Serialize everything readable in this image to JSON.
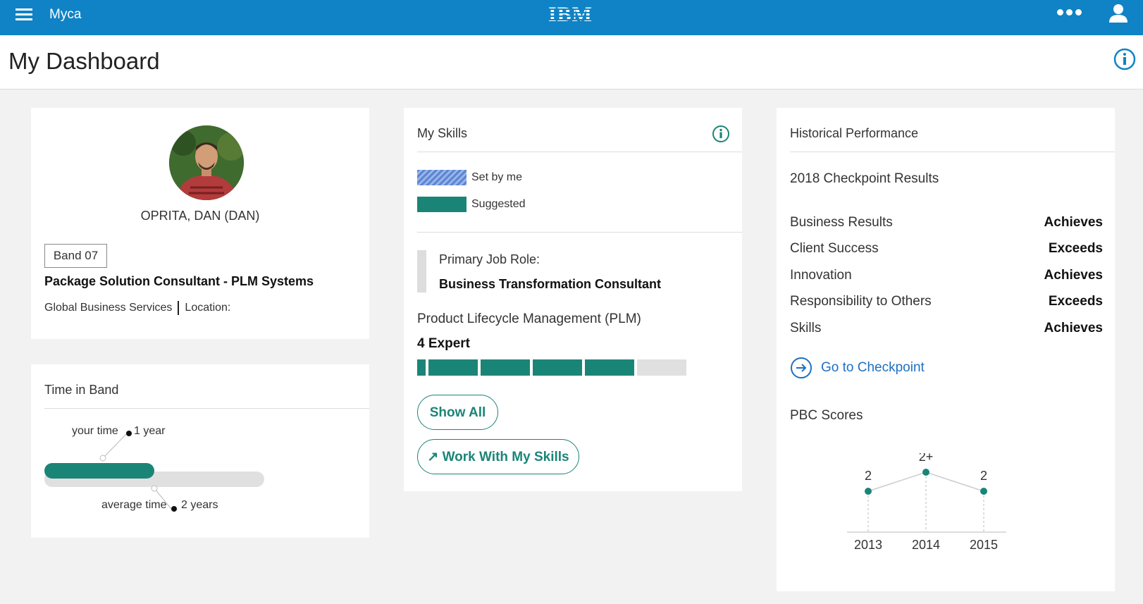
{
  "topbar": {
    "app_name": "Myca",
    "logo": "IBM",
    "menu_icon": "hamburger-icon",
    "more_icon": "more-icon",
    "user_icon": "user-icon"
  },
  "header": {
    "title": "My Dashboard"
  },
  "profile": {
    "name": "OPRITA, DAN (DAN)",
    "band": "Band 07",
    "job_title": "Package Solution Consultant - PLM Systems",
    "org": "Global Business Services",
    "location_label": "Location:"
  },
  "time_in_band": {
    "title": "Time in Band",
    "your_time_label": "your time",
    "your_time_value": "1 year",
    "average_time_label": "average time",
    "average_time_value": "2 years",
    "your_time_years": 1,
    "average_time_years": 2
  },
  "skills": {
    "title": "My Skills",
    "legend": [
      {
        "label": "Set by me"
      },
      {
        "label": "Suggested"
      }
    ],
    "primary_role_label": "Primary Job Role:",
    "primary_role": "Business Transformation Consultant",
    "skill_name": "Product Lifecycle Management (PLM)",
    "skill_level": "4 Expert",
    "skill_level_value": 4,
    "skill_level_max": 5,
    "show_all": "Show All",
    "work_with_skills": "Work With My Skills"
  },
  "performance": {
    "title": "Historical Performance",
    "checkpoint_title": "2018 Checkpoint Results",
    "results": [
      {
        "label": "Business Results",
        "value": "Achieves"
      },
      {
        "label": "Client Success",
        "value": "Exceeds"
      },
      {
        "label": "Innovation",
        "value": "Achieves"
      },
      {
        "label": "Responsibility to Others",
        "value": "Exceeds"
      },
      {
        "label": "Skills",
        "value": "Achieves"
      }
    ],
    "goto_checkpoint": "Go to Checkpoint",
    "pbc_title": "PBC Scores"
  },
  "chart_data": {
    "type": "line",
    "x": [
      "2013",
      "2014",
      "2015"
    ],
    "labels": [
      "2",
      "2+",
      "2"
    ],
    "values": [
      2,
      2.5,
      2
    ]
  },
  "colors": {
    "brand": "#0f83c5",
    "accent": "#1a8577",
    "link": "#1f6fc1"
  }
}
